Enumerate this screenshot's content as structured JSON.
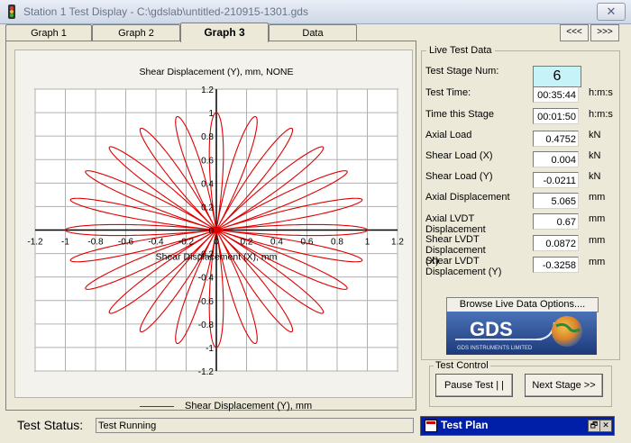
{
  "window": {
    "title": "Station 1 Test Display - C:\\gdslab\\untitled-210915-1301.gds",
    "close_glyph": "✕"
  },
  "tabs": [
    {
      "label": "Graph 1",
      "active": false
    },
    {
      "label": "Graph 2",
      "active": false
    },
    {
      "label": "Graph 3",
      "active": true
    },
    {
      "label": "Data",
      "active": false
    }
  ],
  "nav": {
    "prev_label": "<<<",
    "next_label": ">>>"
  },
  "live": {
    "group_title": "Live Test Data",
    "stage_label": "Test Stage Num:",
    "stage_value": "6",
    "params": [
      {
        "label": "Test Time:",
        "value": "00:35:44",
        "unit": "h:m:s"
      },
      {
        "label": "Time this Stage",
        "value": "00:01:50",
        "unit": "h:m:s"
      },
      {
        "label": "Axial Load",
        "value": "0.4752",
        "unit": "kN"
      },
      {
        "label": "Shear Load (X)",
        "value": "0.004",
        "unit": "kN"
      },
      {
        "label": "Shear Load (Y)",
        "value": "-0.0211",
        "unit": "kN"
      },
      {
        "label": "Axial Displacement",
        "value": "5.065",
        "unit": "mm"
      },
      {
        "label": "Axial LVDT Displacement",
        "value": "0.67",
        "unit": "mm"
      },
      {
        "label": "Shear LVDT Displacement (X)",
        "value": "0.0872",
        "unit": "mm"
      },
      {
        "label": "Shear LVDT Displacement (Y)",
        "value": "-0.3258",
        "unit": "mm"
      }
    ],
    "browse_label": "Browse Live Data Options....",
    "logo_text": "GDS",
    "logo_subtext": "GDS INSTRUMENTS LIMITED"
  },
  "control": {
    "title": "Test Control",
    "pause_label": "Pause Test | |",
    "next_label": "Next Stage >>"
  },
  "status": {
    "label": "Test Status:",
    "value": "Test Running"
  },
  "plan": {
    "title": "Test Plan",
    "restore_glyph": "🗗",
    "close_glyph": "✕"
  },
  "colors": {
    "series": "#e00000",
    "titlebar": "#cfd8e6",
    "plan_bar": "#001fa8",
    "stage_bg": "#c6f3f8"
  },
  "chart_data": {
    "type": "line",
    "title": "Shear Displacement (Y), mm, NONE",
    "xlabel": "Shear Displacement (X), mm",
    "ylabel": "",
    "xlim": [
      -1.2,
      1.2
    ],
    "ylim": [
      -1.2,
      1.2
    ],
    "xticks": [
      "-1.2",
      "-1",
      "-0.8",
      "-0.6",
      "-0.4",
      "-0.2",
      "0",
      "0.2",
      "0.4",
      "0.6",
      "0.8",
      "1",
      "1.2"
    ],
    "yticks": [
      "1.2",
      "1",
      "0.8",
      "0.6",
      "0.4",
      "0.2",
      "0",
      "-0.2",
      "-0.4",
      "-0.6",
      "-0.8",
      "-1",
      "-1.2"
    ],
    "grid": true,
    "legend": "bottom",
    "series": [
      {
        "name": "Shear Displacement (Y), mm",
        "shape": "rose",
        "petals": 24,
        "amplitude": 1.0
      }
    ]
  }
}
